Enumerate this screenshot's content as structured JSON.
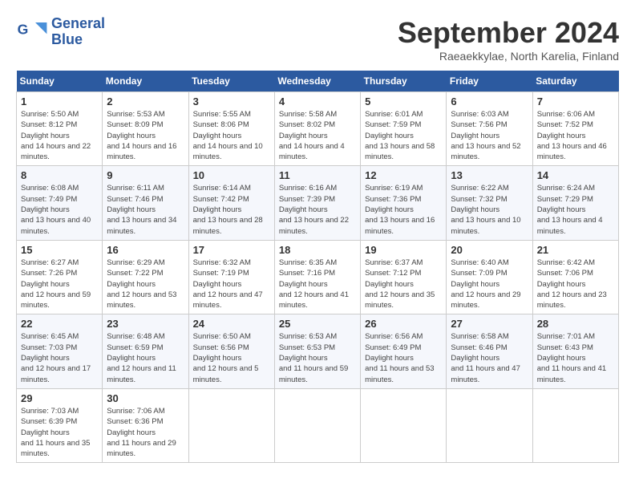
{
  "logo": {
    "line1": "General",
    "line2": "Blue"
  },
  "title": "September 2024",
  "location": "Raeaekkylae, North Karelia, Finland",
  "days_header": [
    "Sunday",
    "Monday",
    "Tuesday",
    "Wednesday",
    "Thursday",
    "Friday",
    "Saturday"
  ],
  "weeks": [
    [
      {
        "num": "1",
        "sunrise": "5:50 AM",
        "sunset": "8:12 PM",
        "daylight": "14 hours and 22 minutes."
      },
      {
        "num": "2",
        "sunrise": "5:53 AM",
        "sunset": "8:09 PM",
        "daylight": "14 hours and 16 minutes."
      },
      {
        "num": "3",
        "sunrise": "5:55 AM",
        "sunset": "8:06 PM",
        "daylight": "14 hours and 10 minutes."
      },
      {
        "num": "4",
        "sunrise": "5:58 AM",
        "sunset": "8:02 PM",
        "daylight": "14 hours and 4 minutes."
      },
      {
        "num": "5",
        "sunrise": "6:01 AM",
        "sunset": "7:59 PM",
        "daylight": "13 hours and 58 minutes."
      },
      {
        "num": "6",
        "sunrise": "6:03 AM",
        "sunset": "7:56 PM",
        "daylight": "13 hours and 52 minutes."
      },
      {
        "num": "7",
        "sunrise": "6:06 AM",
        "sunset": "7:52 PM",
        "daylight": "13 hours and 46 minutes."
      }
    ],
    [
      {
        "num": "8",
        "sunrise": "6:08 AM",
        "sunset": "7:49 PM",
        "daylight": "13 hours and 40 minutes."
      },
      {
        "num": "9",
        "sunrise": "6:11 AM",
        "sunset": "7:46 PM",
        "daylight": "13 hours and 34 minutes."
      },
      {
        "num": "10",
        "sunrise": "6:14 AM",
        "sunset": "7:42 PM",
        "daylight": "13 hours and 28 minutes."
      },
      {
        "num": "11",
        "sunrise": "6:16 AM",
        "sunset": "7:39 PM",
        "daylight": "13 hours and 22 minutes."
      },
      {
        "num": "12",
        "sunrise": "6:19 AM",
        "sunset": "7:36 PM",
        "daylight": "13 hours and 16 minutes."
      },
      {
        "num": "13",
        "sunrise": "6:22 AM",
        "sunset": "7:32 PM",
        "daylight": "13 hours and 10 minutes."
      },
      {
        "num": "14",
        "sunrise": "6:24 AM",
        "sunset": "7:29 PM",
        "daylight": "13 hours and 4 minutes."
      }
    ],
    [
      {
        "num": "15",
        "sunrise": "6:27 AM",
        "sunset": "7:26 PM",
        "daylight": "12 hours and 59 minutes."
      },
      {
        "num": "16",
        "sunrise": "6:29 AM",
        "sunset": "7:22 PM",
        "daylight": "12 hours and 53 minutes."
      },
      {
        "num": "17",
        "sunrise": "6:32 AM",
        "sunset": "7:19 PM",
        "daylight": "12 hours and 47 minutes."
      },
      {
        "num": "18",
        "sunrise": "6:35 AM",
        "sunset": "7:16 PM",
        "daylight": "12 hours and 41 minutes."
      },
      {
        "num": "19",
        "sunrise": "6:37 AM",
        "sunset": "7:12 PM",
        "daylight": "12 hours and 35 minutes."
      },
      {
        "num": "20",
        "sunrise": "6:40 AM",
        "sunset": "7:09 PM",
        "daylight": "12 hours and 29 minutes."
      },
      {
        "num": "21",
        "sunrise": "6:42 AM",
        "sunset": "7:06 PM",
        "daylight": "12 hours and 23 minutes."
      }
    ],
    [
      {
        "num": "22",
        "sunrise": "6:45 AM",
        "sunset": "7:03 PM",
        "daylight": "12 hours and 17 minutes."
      },
      {
        "num": "23",
        "sunrise": "6:48 AM",
        "sunset": "6:59 PM",
        "daylight": "12 hours and 11 minutes."
      },
      {
        "num": "24",
        "sunrise": "6:50 AM",
        "sunset": "6:56 PM",
        "daylight": "12 hours and 5 minutes."
      },
      {
        "num": "25",
        "sunrise": "6:53 AM",
        "sunset": "6:53 PM",
        "daylight": "11 hours and 59 minutes."
      },
      {
        "num": "26",
        "sunrise": "6:56 AM",
        "sunset": "6:49 PM",
        "daylight": "11 hours and 53 minutes."
      },
      {
        "num": "27",
        "sunrise": "6:58 AM",
        "sunset": "6:46 PM",
        "daylight": "11 hours and 47 minutes."
      },
      {
        "num": "28",
        "sunrise": "7:01 AM",
        "sunset": "6:43 PM",
        "daylight": "11 hours and 41 minutes."
      }
    ],
    [
      {
        "num": "29",
        "sunrise": "7:03 AM",
        "sunset": "6:39 PM",
        "daylight": "11 hours and 35 minutes."
      },
      {
        "num": "30",
        "sunrise": "7:06 AM",
        "sunset": "6:36 PM",
        "daylight": "11 hours and 29 minutes."
      },
      null,
      null,
      null,
      null,
      null
    ]
  ]
}
